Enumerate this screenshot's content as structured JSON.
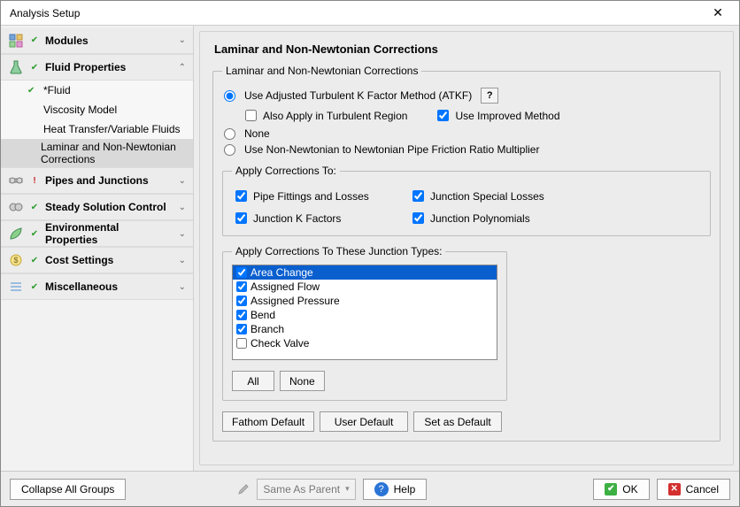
{
  "window": {
    "title": "Analysis Setup"
  },
  "sidebar": {
    "groups": [
      {
        "label": "Modules",
        "icon": "modules",
        "status": "ok",
        "expanded": false
      },
      {
        "label": "Fluid Properties",
        "icon": "fluid",
        "status": "ok",
        "expanded": true,
        "items": [
          {
            "label": "*Fluid",
            "status": "ok"
          },
          {
            "label": "Viscosity Model",
            "status": ""
          },
          {
            "label": "Heat Transfer/Variable Fluids",
            "status": ""
          },
          {
            "label": "Laminar and Non-Newtonian Corrections",
            "status": "",
            "selected": true
          }
        ]
      },
      {
        "label": "Pipes and Junctions",
        "icon": "pipes",
        "status": "warn",
        "expanded": false
      },
      {
        "label": "Steady Solution Control",
        "icon": "steady",
        "status": "ok",
        "expanded": false
      },
      {
        "label": "Environmental Properties",
        "icon": "env",
        "status": "ok",
        "expanded": false
      },
      {
        "label": "Cost Settings",
        "icon": "cost",
        "status": "ok",
        "expanded": false
      },
      {
        "label": "Miscellaneous",
        "icon": "misc",
        "status": "ok",
        "expanded": false
      }
    ]
  },
  "main": {
    "title": "Laminar and Non-Newtonian Corrections",
    "group_legend": "Laminar and Non-Newtonian Corrections",
    "radio_atkf": "Use Adjusted Turbulent K Factor Method (ATKF)",
    "cb_also_apply": "Also Apply in Turbulent Region",
    "cb_improved": "Use Improved Method",
    "radio_none": "None",
    "radio_multiplier": "Use Non-Newtonian to Newtonian Pipe Friction Ratio Multiplier",
    "apply_to_legend": "Apply Corrections To:",
    "cb_pipe_fittings": "Pipe Fittings and Losses",
    "cb_junction_special": "Junction Special Losses",
    "cb_junction_k": "Junction K Factors",
    "cb_junction_poly": "Junction Polynomials",
    "jt_legend": "Apply Corrections To These Junction Types:",
    "jt_items": [
      {
        "label": "Area Change",
        "checked": true,
        "selected": true
      },
      {
        "label": "Assigned Flow",
        "checked": true
      },
      {
        "label": "Assigned Pressure",
        "checked": true
      },
      {
        "label": "Bend",
        "checked": true
      },
      {
        "label": "Branch",
        "checked": true
      },
      {
        "label": "Check Valve",
        "checked": false
      }
    ],
    "all_btn": "All",
    "none_btn": "None",
    "fathom_default": "Fathom Default",
    "user_default": "User Default",
    "set_default": "Set as Default"
  },
  "footer": {
    "collapse": "Collapse All Groups",
    "same_as_parent": "Same As Parent",
    "help": "Help",
    "ok": "OK",
    "cancel": "Cancel"
  }
}
